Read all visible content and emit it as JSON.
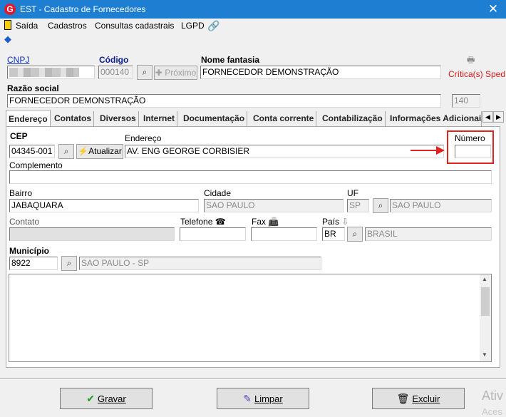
{
  "window": {
    "title": "EST - Cadastro de Fornecedores",
    "icon_letter": "G",
    "close": "✕"
  },
  "menu": {
    "items": [
      "Saída",
      "Cadastros",
      "Consultas cadastrais",
      "LGPD"
    ]
  },
  "header": {
    "cnpj_label": "CNPJ",
    "codigo_label": "Código",
    "codigo_value": "000140",
    "proximo_label": "Próximo",
    "nome_fantasia_label": "Nome fantasia",
    "nome_fantasia_value": "FORNECEDOR DEMONSTRAÇÃO",
    "criticas_label": "Crítica(s) Sped",
    "razao_social_label": "Razão social",
    "razao_social_value": "FORNECEDOR DEMONSTRAÇÃO",
    "razao_social_count": "140"
  },
  "tabs": [
    "Endereço",
    "Contatos",
    "Diversos",
    "Internet",
    "Documentação",
    "Conta corrente",
    "Contabilização",
    "Informações Adicionai"
  ],
  "endereco": {
    "cep_label": "CEP",
    "cep_value": "04345-001",
    "atualizar_label": "Atualizar",
    "endereco_label": "Endereço",
    "endereco_value": "AV. ENG GEORGE CORBISIER",
    "numero_label": "Número",
    "numero_value": "",
    "complemento_label": "Complemento",
    "complemento_value": "",
    "bairro_label": "Bairro",
    "bairro_value": "JABAQUARA",
    "cidade_label": "Cidade",
    "cidade_value": "SAO PAULO",
    "uf_label": "UF",
    "uf_value": "SP",
    "uf_name": "SAO PAULO",
    "contato_label": "Contato",
    "contato_value": "",
    "telefone_label": "Telefone",
    "telefone_value": "",
    "fax_label": "Fax",
    "fax_value": "",
    "pais_label": "País",
    "pais_code": "BR",
    "pais_name": "BRASIL",
    "municipio_label": "Município",
    "municipio_code": "8922",
    "municipio_name": "SAO PAULO - SP"
  },
  "footer": {
    "gravar": "Gravar",
    "limpar": "Limpar",
    "excluir": "Excluir",
    "watermark": "Ativ",
    "watermark2": "Aces"
  }
}
